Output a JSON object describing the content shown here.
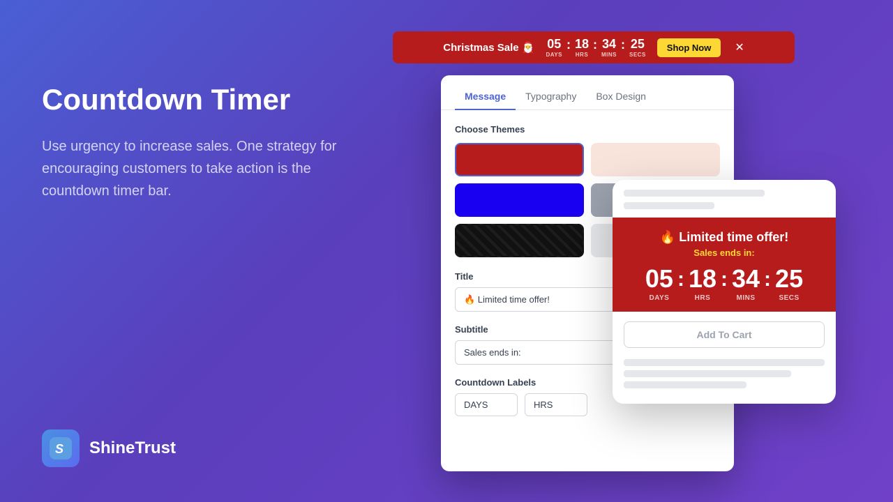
{
  "background": {
    "gradient_start": "#4a5fd4",
    "gradient_end": "#7040c8"
  },
  "left_panel": {
    "title": "Countdown Timer",
    "description": "Use urgency to increase sales. One strategy for encouraging customers to take action is the countdown timer bar."
  },
  "logo": {
    "icon_text": "S",
    "name": "ShineTrust"
  },
  "countdown_bar": {
    "title": "Christmas Sale 🎅",
    "days_num": "05",
    "days_label": "DAYS",
    "hrs_num": "18",
    "hrs_label": "HRS",
    "mins_num": "34",
    "mins_label": "MINS",
    "secs_num": "25",
    "secs_label": "SECS",
    "shop_now_label": "Shop Now",
    "separator": ":"
  },
  "editor": {
    "tabs": [
      {
        "id": "message",
        "label": "Message",
        "active": true
      },
      {
        "id": "typography",
        "label": "Typography",
        "active": false
      },
      {
        "id": "box-design",
        "label": "Box Design",
        "active": false
      }
    ],
    "choose_themes_label": "Choose Themes",
    "themes": [
      {
        "id": "red",
        "class": "theme-red",
        "selected": true
      },
      {
        "id": "light",
        "class": "theme-light",
        "selected": false
      },
      {
        "id": "blue",
        "class": "theme-blue",
        "selected": false
      },
      {
        "id": "gray",
        "class": "theme-gray",
        "selected": false
      },
      {
        "id": "dark",
        "class": "theme-dark",
        "selected": false
      },
      {
        "id": "empty",
        "class": "theme-empty",
        "selected": false
      }
    ],
    "title_label": "Title",
    "title_value": "🔥 Limited time offer!",
    "title_placeholder": "🔥 Limited time offer!",
    "subtitle_label": "Subtitle",
    "subtitle_value": "Sales ends in:",
    "subtitle_placeholder": "Sales ends in:",
    "countdown_labels_label": "Countdown Labels",
    "days_input_value": "DAYS",
    "hrs_input_value": "HRS"
  },
  "product_preview": {
    "title": "🔥 Limited time offer!",
    "subtitle": "Sales ends in:",
    "days_num": "05",
    "days_label": "DAYS",
    "hrs_num": "18",
    "hrs_label": "HRS",
    "mins_num": "34",
    "mins_label": "MINS",
    "secs_num": "25",
    "secs_label": "SECS",
    "separator": ":",
    "add_to_cart_label": "Add To Cart"
  }
}
